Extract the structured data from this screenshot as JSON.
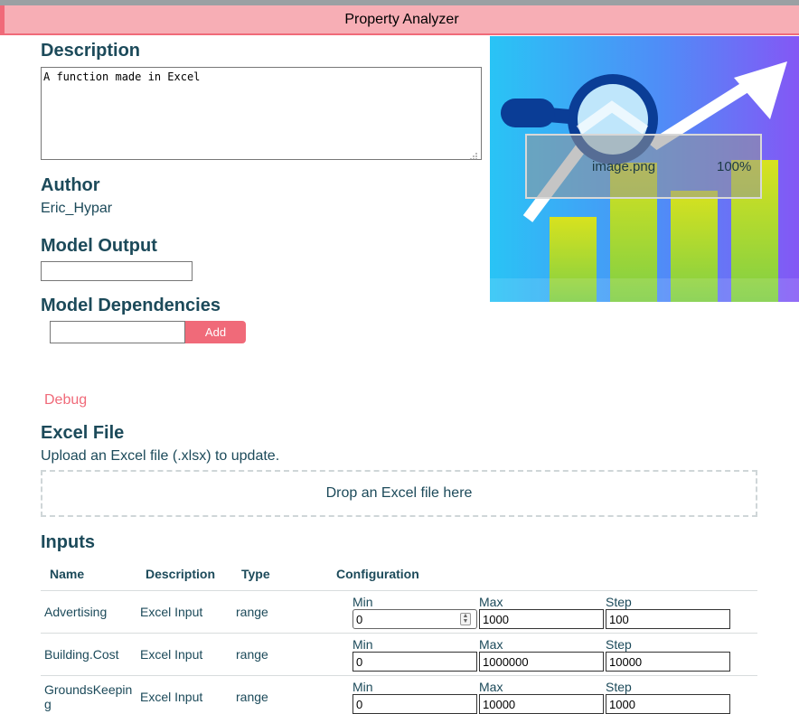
{
  "app": {
    "title": "Property Analyzer"
  },
  "description": {
    "heading": "Description",
    "value": "A function made in Excel"
  },
  "author": {
    "heading": "Author",
    "value": "Eric_Hypar"
  },
  "model_output": {
    "heading": "Model Output",
    "value": ""
  },
  "model_dependencies": {
    "heading": "Model Dependencies",
    "value": "",
    "add_label": "Add"
  },
  "debug": {
    "label": "Debug"
  },
  "excel_file": {
    "heading": "Excel File",
    "upload_text": "Upload an Excel file (.xlsx) to update.",
    "dropzone_label": "Drop an Excel file here"
  },
  "preview": {
    "filename": "image.png",
    "zoom": "100%"
  },
  "inputs": {
    "heading": "Inputs",
    "columns": {
      "name": "Name",
      "description": "Description",
      "type": "Type",
      "configuration": "Configuration"
    },
    "config_labels": {
      "min": "Min",
      "max": "Max",
      "step": "Step"
    },
    "rows": [
      {
        "name": "Advertising",
        "description": "Excel Input",
        "type": "range",
        "min": "0",
        "max": "1000",
        "step": "100"
      },
      {
        "name": "Building.Cost",
        "description": "Excel Input",
        "type": "range",
        "min": "0",
        "max": "1000000",
        "step": "10000"
      },
      {
        "name": "GroundsKeeping",
        "description": "Excel Input",
        "type": "range",
        "min": "0",
        "max": "10000",
        "step": "1000"
      }
    ]
  },
  "colors": {
    "accent": "#f06a79",
    "titlebar_bg": "#f7aeb5",
    "text": "#1c4a5a"
  }
}
